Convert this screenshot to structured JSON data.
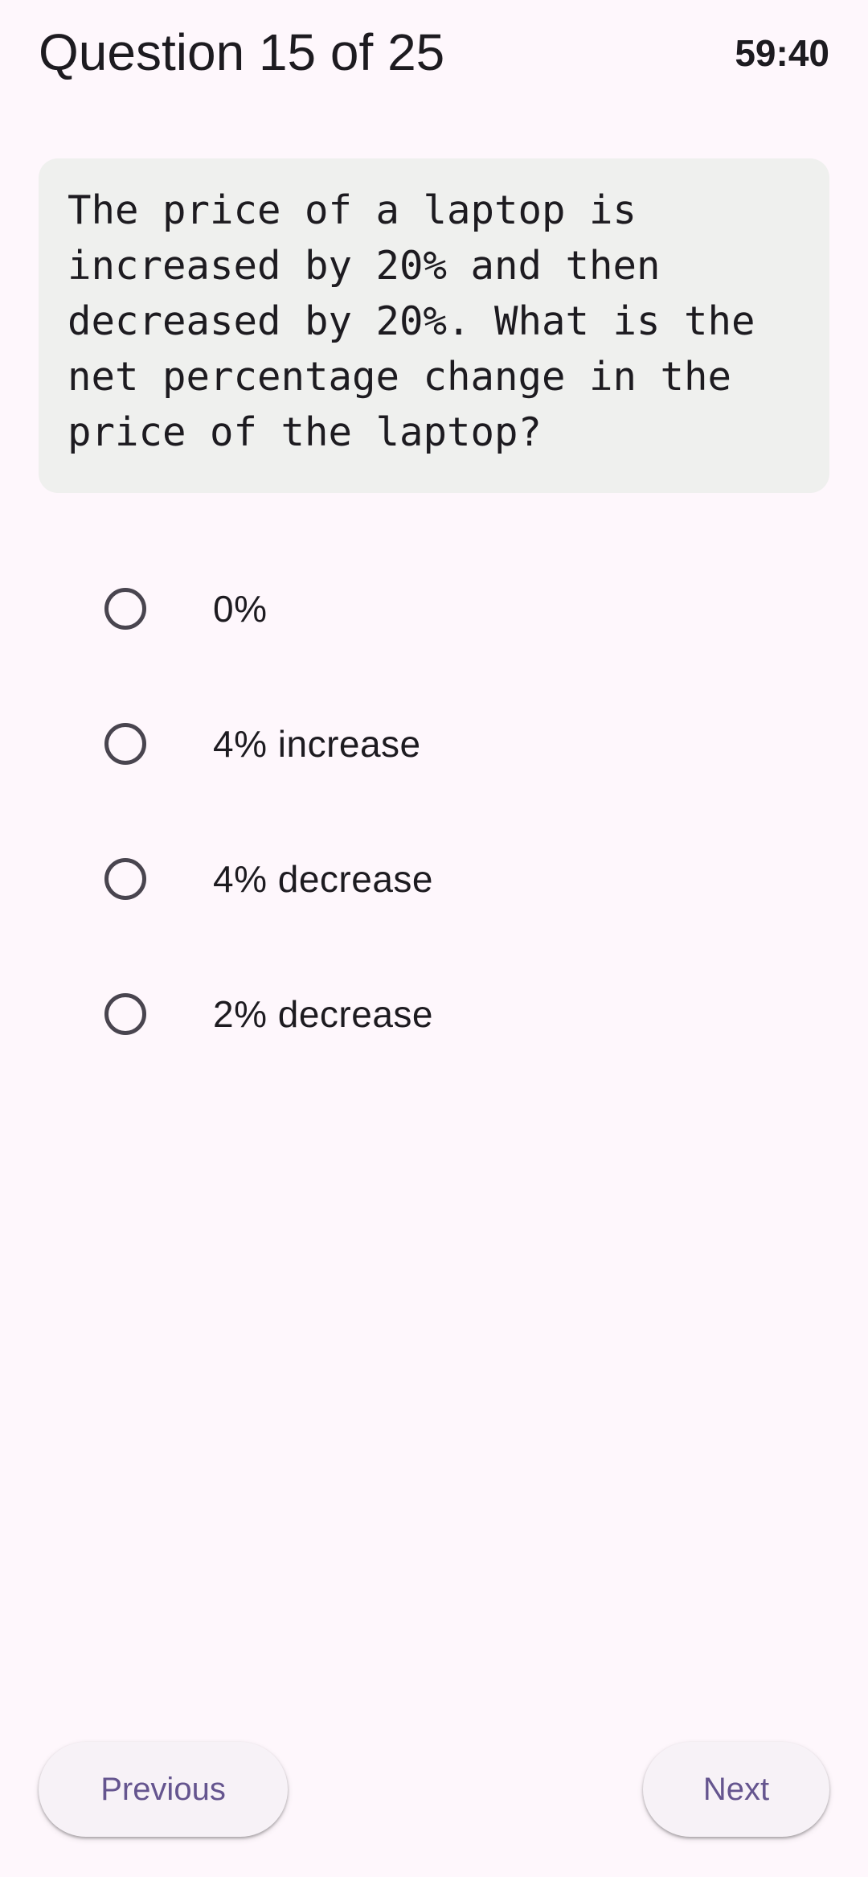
{
  "header": {
    "title": "Question 15 of 25",
    "timer": "59:40"
  },
  "question": {
    "text": "The price of a laptop is increased by 20% and then decreased by 20%. What is the net percentage change in the price of the laptop?"
  },
  "options": [
    {
      "label": "0%",
      "selected": false
    },
    {
      "label": "4% increase",
      "selected": false
    },
    {
      "label": "4% decrease",
      "selected": false
    },
    {
      "label": "2% decrease",
      "selected": false
    }
  ],
  "navigation": {
    "previous_label": "Previous",
    "next_label": "Next"
  },
  "colors": {
    "background": "#fef7fc",
    "card": "#eff0ee",
    "accent": "#65558f",
    "radio_outline": "#49454f",
    "text": "#1d1b20"
  }
}
